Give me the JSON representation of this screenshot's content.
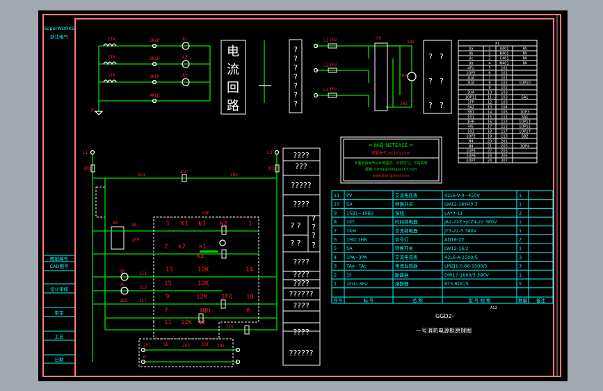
{
  "sidebar": {
    "brand": "SuperWORKS",
    "brand_sub": "浙江电气",
    "fields": [
      "图纸编号",
      "CAD图号",
      "设计审核",
      "审定",
      "工艺",
      "日期"
    ]
  },
  "meter_section": {
    "title_chars": [
      "电",
      "流",
      "回",
      "路"
    ],
    "labels": [
      "1TA",
      "1TA",
      "1TA",
      "A1",
      "A2",
      "A3",
      "1KLP",
      "2KLP",
      "3KLP",
      "4KLP",
      "N"
    ]
  },
  "question_boxes": {
    "middle": [
      "?",
      "?",
      "?",
      "?",
      "?",
      "?",
      "?"
    ],
    "right": [
      "?",
      "?",
      "?",
      "?",
      "?",
      "?"
    ]
  },
  "voltage_section": {
    "labels": [
      "L1",
      "L2",
      "L3",
      "1FU",
      "2FU",
      "3FU",
      "SV",
      "PV",
      "1BS",
      "2BS"
    ]
  },
  "netease_box": {
    "title": "= 网易 NETEASE =",
    "line1": "网易电气  co.163.com",
    "line2": "本图纸由电气设计网提供，仅供学习，不得商用",
    "line3": "邮箱: hztdq@netease163.com",
    "line4": "www.dianqisheji.com"
  },
  "terminal_table": {
    "header": "X1",
    "rows": [
      [
        "Ua",
        "1",
        "A401",
        "PA"
      ],
      [
        "Ub",
        "2",
        "B401",
        "PA"
      ],
      [
        "Uc",
        "3",
        "C401",
        "PA"
      ],
      [
        "Ua",
        "4",
        "N401",
        "PA"
      ],
      [
        "4FU",
        "5",
        "101",
        ""
      ],
      [
        "1OP2",
        "6",
        "101",
        ""
      ],
      [
        "2UA",
        "7",
        "101",
        ""
      ],
      [
        "3UA",
        "8",
        "102",
        "1OP10"
      ],
      [
        "",
        "9",
        "102",
        ""
      ],
      [
        "2UA",
        "10",
        "103",
        ""
      ],
      [
        "1OP11",
        "11",
        "103",
        "SA1"
      ],
      [
        "1FP",
        "12",
        "103",
        ""
      ],
      [
        "SA2",
        "13",
        "104",
        ""
      ],
      [
        "SB1",
        "14",
        "105",
        "1OP3"
      ],
      [
        "101",
        "15",
        "111",
        "SA1"
      ],
      [
        "1HR",
        "16",
        "113",
        "1OP13"
      ],
      [
        "HG",
        "17",
        "113",
        "1OP15"
      ],
      [
        "101",
        "18",
        "117",
        "1OP17"
      ],
      [
        "1OP2",
        "19",
        "113",
        "SB2"
      ],
      [
        "N4",
        "20",
        "201",
        ""
      ],
      [
        "N4",
        "21",
        "203",
        "1OP4"
      ],
      [
        "1OP5",
        "22",
        "203",
        ""
      ],
      [
        "1OP6",
        "23",
        "205",
        ""
      ],
      [
        "1OP7",
        "24",
        "207",
        ""
      ]
    ]
  },
  "control_circuit": {
    "labels": {
      "top_left": "L1",
      "top_right": "L3",
      "fuse_left": "1FU",
      "fuse_right": "3FU",
      "bus_left": "101",
      "bus_right": "102",
      "coil_top": "KV",
      "sa": "SA",
      "sb": "SB",
      "fp": "1FP",
      "hr": "HR",
      "hg": "HG",
      "sb2": "SB2",
      "box": "1QF",
      "w111": "111",
      "w113": "113",
      "w117": "117",
      "w119": "119"
    },
    "terminals": [
      "3",
      "K1",
      "k1",
      "k2",
      "1",
      "2",
      "k2",
      "k1",
      "K1",
      "13",
      "12K",
      "14",
      "15",
      "12K",
      "9",
      "12K",
      "1FQ",
      "10",
      "7",
      "1QQ",
      "8",
      "11",
      "12K",
      "12"
    ],
    "bottom_labels": [
      "201",
      "SB",
      "203",
      "1QF",
      "205",
      "N"
    ]
  },
  "side_legend": [
    "????",
    "???",
    "?????",
    "????",
    "? ?",
    "? ?",
    "?",
    "?",
    "?",
    "?",
    "????",
    "????",
    "????",
    "??????",
    "????",
    "????",
    "??????"
  ],
  "parts_table": {
    "headers": [
      "序号",
      "标 号",
      "名 称",
      "型 号 规 格",
      "数量",
      "备注"
    ],
    "rows": [
      [
        "11",
        "PV",
        "交流电压表",
        "42L6-V-0~450V",
        "1",
        ""
      ],
      [
        "10",
        "SA",
        "转换开关",
        "LW12-16YH3-3",
        "1",
        ""
      ],
      [
        "9",
        "1SB1~1SB2",
        "按钮",
        "LAY3-11",
        "2",
        ""
      ],
      [
        "8",
        "1KT",
        "时间继电器",
        "JA2-22Z+JCZ4-22 380V",
        "1",
        ""
      ],
      [
        "7",
        "1KM",
        "交流继电器",
        "JT3-22-5 380V",
        "1",
        ""
      ],
      [
        "6",
        "1HG,1HR",
        "信号灯",
        "AD16-22",
        "2",
        ""
      ],
      [
        "5",
        "SA",
        "转换开关",
        "LW12-16/2",
        "1",
        ""
      ],
      [
        "4",
        "1PA~3PA",
        "交流电流表",
        "42L6-A-1500/5",
        "3",
        ""
      ],
      [
        "3",
        "TAa~TAc",
        "电流互感器",
        "LMZJ1-0.66-1500/5",
        "3",
        ""
      ],
      [
        "2",
        "1F",
        "断路器",
        "DW17-1600/3 380V",
        "1",
        ""
      ],
      [
        "1",
        "1FU~3FU",
        "熔断器",
        "RT3-RDC/5",
        "5",
        ""
      ]
    ]
  },
  "title_block": {
    "sheet_size": "A12",
    "drawing_code": "GGD2-",
    "drawing_title": "一号消防电源柜原理图"
  },
  "colors": {
    "wire": "#00e000",
    "label": "#ff2020",
    "table": "#00ffff",
    "frame": "#ff7b7b",
    "background": "#000000"
  }
}
